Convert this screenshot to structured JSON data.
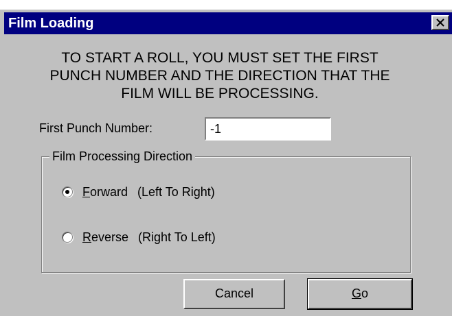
{
  "dialog": {
    "title": "Film Loading",
    "message_lines": [
      "TO START A ROLL, YOU MUST SET THE FIRST",
      "PUNCH NUMBER AND THE DIRECTION THAT THE",
      "FILM WILL BE PROCESSING."
    ],
    "first_punch": {
      "label": "First Punch Number:",
      "value": "-1"
    },
    "direction_group": {
      "legend": "Film Processing Direction",
      "options": [
        {
          "mnemonic": "F",
          "label_rest": "orward",
          "hint": "(Left To Right)",
          "checked": true
        },
        {
          "mnemonic": "R",
          "label_rest": "everse",
          "hint": "(Right To Left)",
          "checked": false
        }
      ]
    },
    "buttons": {
      "cancel": "Cancel",
      "go_mnemonic": "G",
      "go_rest": "o"
    }
  },
  "colors": {
    "titlebar": "#000080",
    "face": "#c0c0c0"
  }
}
